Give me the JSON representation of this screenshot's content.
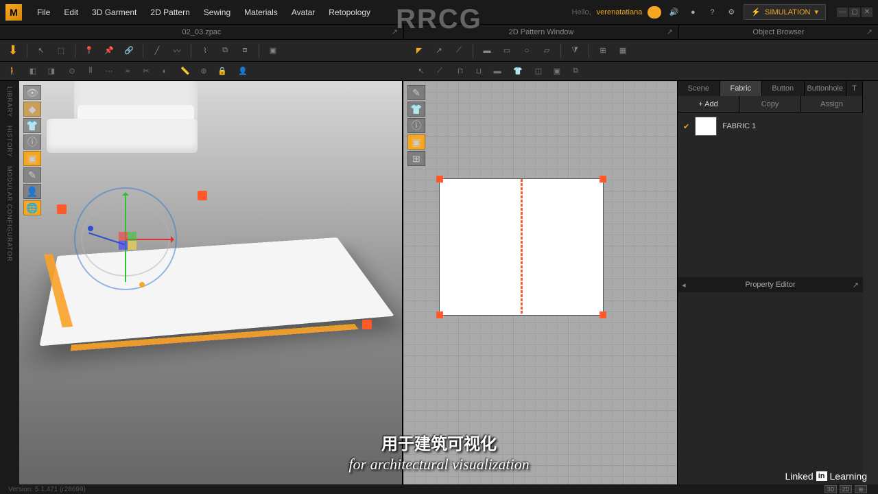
{
  "menubar": {
    "items": [
      "File",
      "Edit",
      "3D Garment",
      "2D Pattern",
      "Sewing",
      "Materials",
      "Avatar",
      "Retopology"
    ],
    "hello": "Hello,",
    "user": "verenatatiana",
    "simulation_label": "SIMULATION"
  },
  "tabs": {
    "left_title": "02_03.zpac",
    "right_title": "2D Pattern Window"
  },
  "left_strip": {
    "items": [
      "LIBRARY",
      "HISTORY",
      "MODULAR CONFIGURATOR"
    ]
  },
  "object_browser": {
    "title": "Object Browser",
    "tabs": [
      "Scene",
      "Fabric",
      "Button",
      "Buttonhole",
      "T"
    ],
    "active_tab": 1,
    "actions": {
      "add": "+ Add",
      "copy": "Copy",
      "assign": "Assign"
    },
    "items": [
      {
        "name": "FABRIC 1"
      }
    ]
  },
  "property_editor": {
    "title": "Property Editor"
  },
  "status": {
    "version": "Version: 5.1.471 (r28699)"
  },
  "subtitle": {
    "cn": "用于建筑可视化",
    "en": "for architectural visualization"
  },
  "watermark": {
    "rrcg": "RRCG",
    "linkedin": "Linked",
    "in": "in",
    "learning": "Learning"
  }
}
